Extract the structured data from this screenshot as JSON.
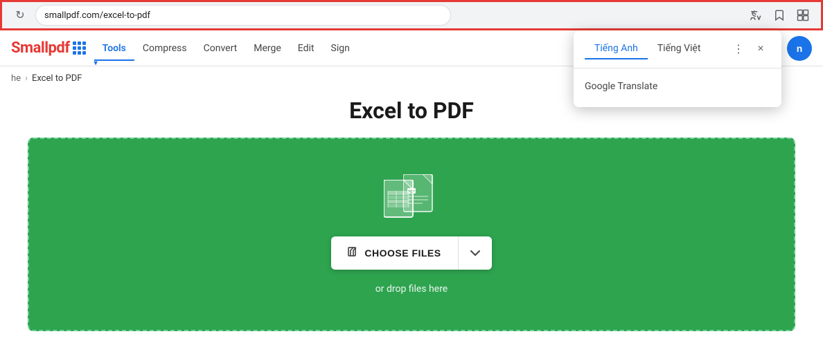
{
  "browser": {
    "url": "smallpdf.com/excel-to-pdf",
    "reload_icon": "↻",
    "translate_icon": "⬜",
    "bookmark_icon": "☆",
    "extensions_icon": "⊡"
  },
  "translate_popup": {
    "tab1": "Tiếng Anh",
    "tab2": "Tiếng Việt",
    "more_icon": "⋮",
    "close_icon": "×",
    "source_label": "Google Translate"
  },
  "navbar": {
    "logo": "Smallpdf",
    "tools_label": "Tools",
    "compress_label": "Compress",
    "convert_label": "Convert",
    "merge_label": "Merge",
    "edit_label": "Edit",
    "sign_label": "Sign",
    "login_label": "n"
  },
  "breadcrumb": {
    "home": "he",
    "separator": "›",
    "current": "Excel to PDF"
  },
  "main": {
    "title": "Excel to PDF",
    "choose_files_label": "CHOOSE FILES",
    "drop_text": "or drop files here"
  }
}
